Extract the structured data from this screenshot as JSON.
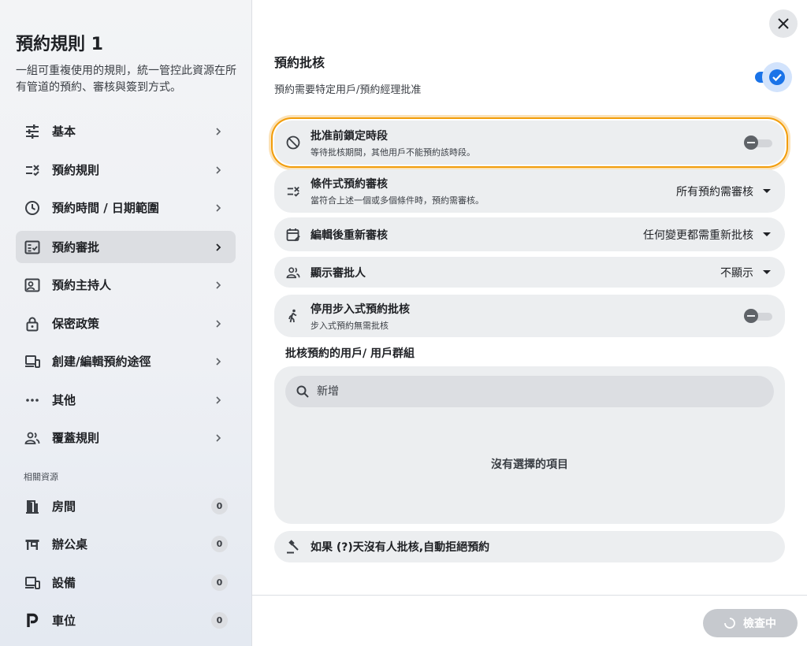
{
  "sidebar": {
    "title": "預約規則 1",
    "description": "一組可重複使用的規則，統一管控此資源在所有管道的預約、審核與簽到方式。",
    "items": [
      {
        "label": "基本",
        "icon": "tune-icon"
      },
      {
        "label": "預約規則",
        "icon": "rule-icon"
      },
      {
        "label": "預約時間 / 日期範圍",
        "icon": "clock-icon"
      },
      {
        "label": "預約審批",
        "icon": "fact-check-icon"
      },
      {
        "label": "預約主持人",
        "icon": "host-card-icon"
      },
      {
        "label": "保密政策",
        "icon": "lock-icon"
      },
      {
        "label": "創建/編輯預約途徑",
        "icon": "devices-icon"
      },
      {
        "label": "其他",
        "icon": "more-horiz-icon"
      },
      {
        "label": "覆蓋規則",
        "icon": "group-icon"
      }
    ],
    "active_index": 3,
    "resources_label": "相關資源",
    "resources": [
      {
        "label": "房間",
        "count": "0",
        "icon": "door-icon"
      },
      {
        "label": "辦公桌",
        "count": "0",
        "icon": "desk-icon"
      },
      {
        "label": "設備",
        "count": "0",
        "icon": "devices-icon"
      },
      {
        "label": "車位",
        "count": "0",
        "icon": "parking-icon"
      }
    ]
  },
  "main": {
    "section_title": "預約批核",
    "section_desc": "預約需要特定用戶/預約經理批准",
    "section_enabled": true,
    "rows": [
      {
        "title": "批准前鎖定時段",
        "sub": "等待批核期間，其他用戶不能預約該時段。",
        "control": "toggle",
        "enabled": false
      },
      {
        "title": "條件式預約審核",
        "sub": "當符合上述一個或多個條件時，預約需審核。",
        "control": "select",
        "value": "所有預約需審核"
      },
      {
        "title": "編輯後重新審核",
        "sub": "",
        "control": "select",
        "value": "任何變更都需重新批核"
      },
      {
        "title": "顯示審批人",
        "sub": "",
        "control": "select",
        "value": "不顯示"
      },
      {
        "title": "停用步入式預約批核",
        "sub": "步入式預約無需批核",
        "control": "toggle",
        "enabled": false
      }
    ],
    "approvers_label": "批核預約的用戶/ 用戶群組",
    "search_placeholder": "新增",
    "empty_text": "沒有選擇的項目",
    "auto_reject_label": "如果 (?)天沒有人批核,自動拒絕預約"
  },
  "footer": {
    "check_label": "檢查中"
  },
  "colors": {
    "accent": "#1a73e8",
    "focus_ring": "#f29d0a",
    "row_bg": "#eceef0",
    "active_nav": "#dcdee2"
  }
}
